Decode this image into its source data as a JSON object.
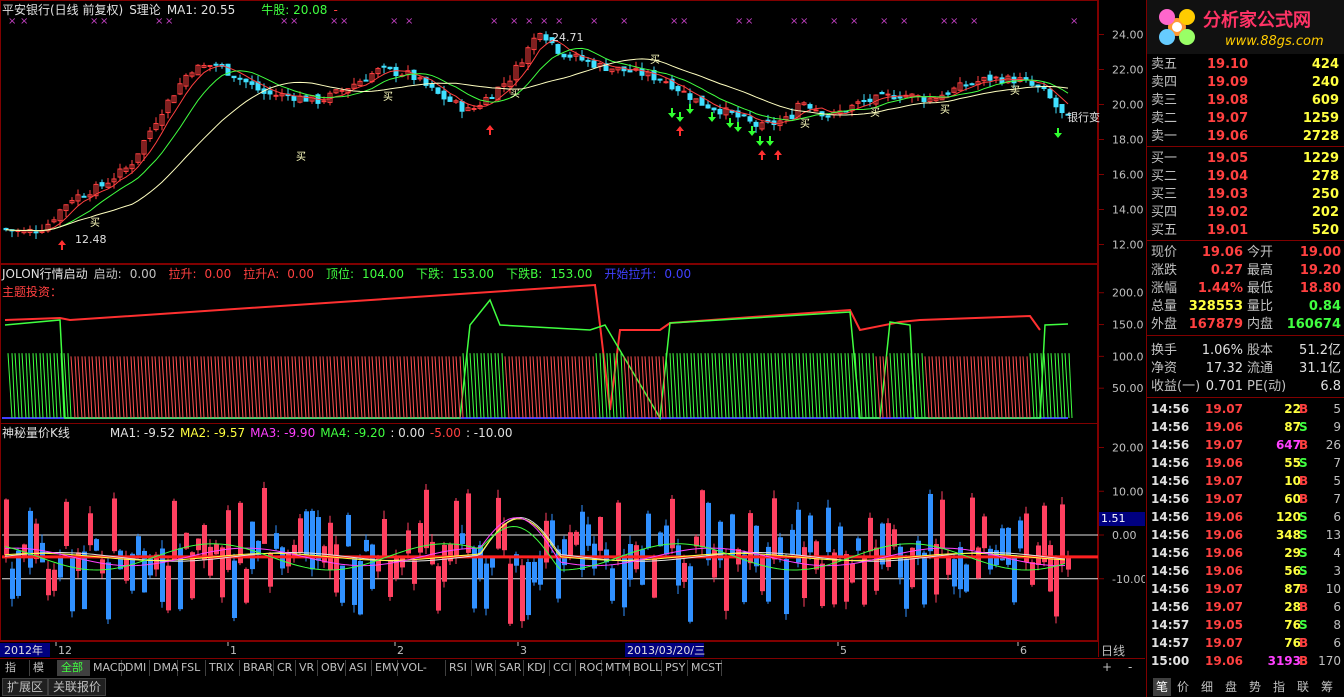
{
  "main": {
    "title": "平安银行(日线 前复权)",
    "indicator": "S理论",
    "ma1": "MA1: 20.55",
    "bull_label": "牛股: 20.08",
    "bull_suffix": "-",
    "price_ticks": [
      "24.00",
      "22.00",
      "20.00",
      "18.00",
      "16.00",
      "14.00",
      "12.00"
    ],
    "high_label": "24.71",
    "low_label": "12.48",
    "side_label": "银行变",
    "buy_label": "买"
  },
  "ind1": {
    "name": "JOLON行情启动",
    "items": [
      {
        "label": "启动:",
        "value": "0.00",
        "color": "#c0c0c0"
      },
      {
        "label": "拉升:",
        "value": "0.00",
        "color": "#ff4040"
      },
      {
        "label": "拉升A:",
        "value": "0.00",
        "color": "#ff4040"
      },
      {
        "label": "顶位:",
        "value": "104.00",
        "color": "#40ff40"
      },
      {
        "label": "下跌:",
        "value": "153.00",
        "color": "#40ff40"
      },
      {
        "label": "下跌B:",
        "value": "153.00",
        "color": "#40ff40"
      },
      {
        "label": "开始拉升:",
        "value": "0.00",
        "color": "#4040ff"
      }
    ],
    "sub_label": "主题投资：",
    "ticks": [
      "200.0",
      "150.0",
      "100.0",
      "50.00"
    ]
  },
  "ind2": {
    "name": "神秘量价K线",
    "items": [
      {
        "text": "MA1: -9.52",
        "color": "#e0e0e0"
      },
      {
        "text": "MA2: -9.57",
        "color": "#ffff40"
      },
      {
        "text": "MA3: -9.90",
        "color": "#ff40ff"
      },
      {
        "text": "MA4: -9.20",
        "color": "#40ff40"
      },
      {
        "text": ": 0.00",
        "color": "#e0e0e0"
      },
      {
        "text": "-5.00",
        "color": "#ff4040"
      },
      {
        "text": ": -10.00",
        "color": "#e0e0e0"
      }
    ],
    "ticks": [
      "20.00",
      "10.00",
      "0.00",
      "-10.00"
    ],
    "cursor_value": "1.51"
  },
  "time_axis": {
    "year": "2012年",
    "labels": [
      "12",
      "1",
      "2",
      "3",
      "5",
      "6"
    ],
    "cursor_date": "2013/03/20/三",
    "period": "日线"
  },
  "tabs": [
    "指标",
    "模板",
    "全部",
    "MACD",
    "DMI",
    "DMA",
    "FSL",
    "TRIX",
    "BRAR",
    "CR",
    "VR",
    "OBV",
    "ASI",
    "EMV",
    "VOL-TDX",
    "RSI",
    "WR",
    "SAR",
    "KDJ",
    "CCI",
    "ROC",
    "MTM",
    "BOLL",
    "PSY",
    "MCST"
  ],
  "tabs2": [
    "扩展区",
    "关联报价"
  ],
  "zoom": {
    "plus": "+",
    "minus": "-"
  },
  "logo": {
    "text": "分析家公式网",
    "url": "www.88gs.com"
  },
  "order_book": {
    "asks": [
      {
        "label": "卖五",
        "price": "19.10",
        "vol": "424"
      },
      {
        "label": "卖四",
        "price": "19.09",
        "vol": "240"
      },
      {
        "label": "卖三",
        "price": "19.08",
        "vol": "609"
      },
      {
        "label": "卖二",
        "price": "19.07",
        "vol": "1259"
      },
      {
        "label": "卖一",
        "price": "19.06",
        "vol": "2728"
      }
    ],
    "bids": [
      {
        "label": "买一",
        "price": "19.05",
        "vol": "1229"
      },
      {
        "label": "买二",
        "price": "19.04",
        "vol": "278"
      },
      {
        "label": "买三",
        "price": "19.03",
        "vol": "250"
      },
      {
        "label": "买四",
        "price": "19.02",
        "vol": "202"
      },
      {
        "label": "买五",
        "price": "19.01",
        "vol": "520"
      }
    ]
  },
  "quote": [
    {
      "l1": "现价",
      "v1": "19.06",
      "c1": "#ff4040",
      "l2": "今开",
      "v2": "19.00",
      "c2": "#ff4040"
    },
    {
      "l1": "涨跌",
      "v1": "0.27",
      "c1": "#ff4040",
      "l2": "最高",
      "v2": "19.20",
      "c2": "#ff4040"
    },
    {
      "l1": "涨幅",
      "v1": "1.44%",
      "c1": "#ff4040",
      "l2": "最低",
      "v2": "18.80",
      "c2": "#ff4040"
    },
    {
      "l1": "总量",
      "v1": "328553",
      "c1": "#ffff40",
      "l2": "量比",
      "v2": "0.84",
      "c2": "#40ff40"
    },
    {
      "l1": "外盘",
      "v1": "167879",
      "c1": "#ff4040",
      "l2": "内盘",
      "v2": "160674",
      "c2": "#40ff40"
    }
  ],
  "finance": [
    {
      "l1": "换手",
      "v1": "1.06%",
      "l2": "股本",
      "v2": "51.2亿"
    },
    {
      "l1": "净资",
      "v1": "17.32",
      "l2": "流通",
      "v2": "31.1亿"
    },
    {
      "l1": "收益(一)",
      "v1": "0.701",
      "l2": "PE(动)",
      "v2": "6.8"
    }
  ],
  "ticks_list": [
    {
      "time": "14:56",
      "price": "19.07",
      "vol": "22",
      "bs": "B",
      "n": "5",
      "vc": "#ffff40"
    },
    {
      "time": "14:56",
      "price": "19.06",
      "vol": "87",
      "bs": "S",
      "n": "9",
      "vc": "#ffff40"
    },
    {
      "time": "14:56",
      "price": "19.07",
      "vol": "647",
      "bs": "B",
      "n": "26",
      "vc": "#ff40ff"
    },
    {
      "time": "14:56",
      "price": "19.06",
      "vol": "55",
      "bs": "S",
      "n": "7",
      "vc": "#ffff40"
    },
    {
      "time": "14:56",
      "price": "19.07",
      "vol": "10",
      "bs": "B",
      "n": "5",
      "vc": "#ffff40"
    },
    {
      "time": "14:56",
      "price": "19.07",
      "vol": "60",
      "bs": "B",
      "n": "7",
      "vc": "#ffff40"
    },
    {
      "time": "14:56",
      "price": "19.06",
      "vol": "120",
      "bs": "S",
      "n": "6",
      "vc": "#ffff40"
    },
    {
      "time": "14:56",
      "price": "19.06",
      "vol": "348",
      "bs": "S",
      "n": "13",
      "vc": "#ffff40"
    },
    {
      "time": "14:56",
      "price": "19.06",
      "vol": "29",
      "bs": "S",
      "n": "4",
      "vc": "#ffff40"
    },
    {
      "time": "14:56",
      "price": "19.06",
      "vol": "56",
      "bs": "S",
      "n": "3",
      "vc": "#ffff40"
    },
    {
      "time": "14:56",
      "price": "19.07",
      "vol": "87",
      "bs": "B",
      "n": "10",
      "vc": "#ffff40"
    },
    {
      "time": "14:56",
      "price": "19.07",
      "vol": "28",
      "bs": "B",
      "n": "6",
      "vc": "#ffff40"
    },
    {
      "time": "14:57",
      "price": "19.05",
      "vol": "76",
      "bs": "S",
      "n": "8",
      "vc": "#ffff40"
    },
    {
      "time": "14:57",
      "price": "19.07",
      "vol": "76",
      "bs": "B",
      "n": "6",
      "vc": "#ffff40"
    },
    {
      "time": "15:00",
      "price": "19.06",
      "vol": "3193",
      "bs": "B",
      "n": "170",
      "vc": "#ff40ff"
    }
  ],
  "bottom_right_tabs": [
    "笔",
    "价",
    "细",
    "盘",
    "势",
    "指",
    "联",
    "筹"
  ]
}
